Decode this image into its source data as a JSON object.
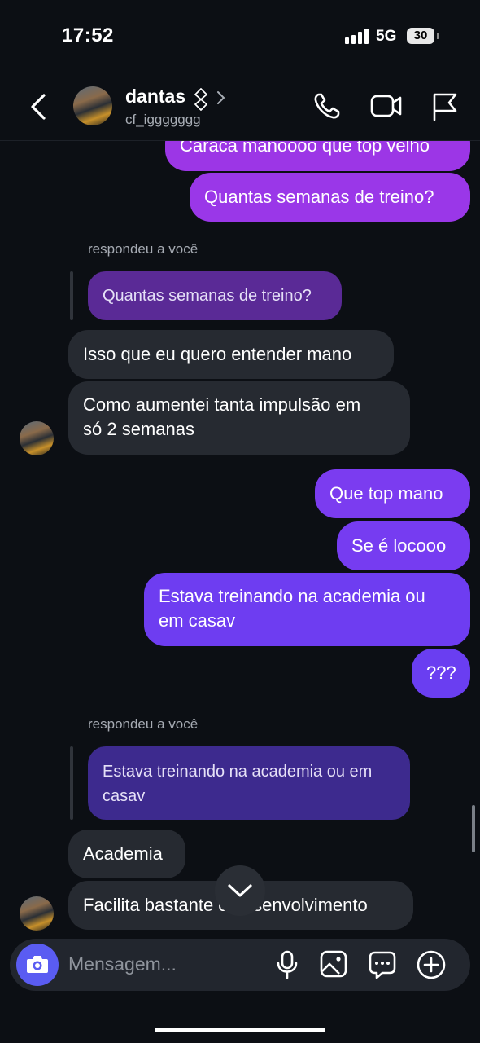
{
  "status_bar": {
    "time": "17:52",
    "network": "5G",
    "battery": "30"
  },
  "header": {
    "contact_name": "dantas",
    "contact_handle": "cf_iggggggg",
    "icons": [
      "back-icon",
      "verified-icon",
      "chevron-right-icon",
      "phone-icon",
      "video-icon",
      "flag-icon"
    ]
  },
  "messages": {
    "m1": "Caraca manoooo que top velho",
    "m2": "Quantas semanas de treino?",
    "reply1_label": "respondeu a você",
    "reply1_quote": "Quantas semanas de treino?",
    "m3": "Isso que eu quero entender mano",
    "m4_line1": "Como aumentei tanta impulsão em",
    "m4_line2": "só 2 semanas",
    "m5": "Que top mano",
    "m6": "Se é locooo",
    "m7_line1": "Estava treinando na academia ou",
    "m7_line2": "em casav",
    "m8": "???",
    "reply2_label": "respondeu a você",
    "reply2_quote_line1": "Estava treinando na academia ou em",
    "reply2_quote_line2": "casav",
    "m9": "Academia",
    "m10": "Facilita bastante o desenvolvimento"
  },
  "composer": {
    "placeholder": "Mensagem...",
    "icons": [
      "camera-icon",
      "microphone-icon",
      "gallery-icon",
      "sticker-icon",
      "add-icon"
    ]
  },
  "colors": {
    "background": "#0c0f14",
    "incoming_bubble": "#262a31",
    "outgoing_magenta": "#9b36e6",
    "outgoing_violet": "#6d3df0",
    "camera_button": "#5a5cf2"
  }
}
